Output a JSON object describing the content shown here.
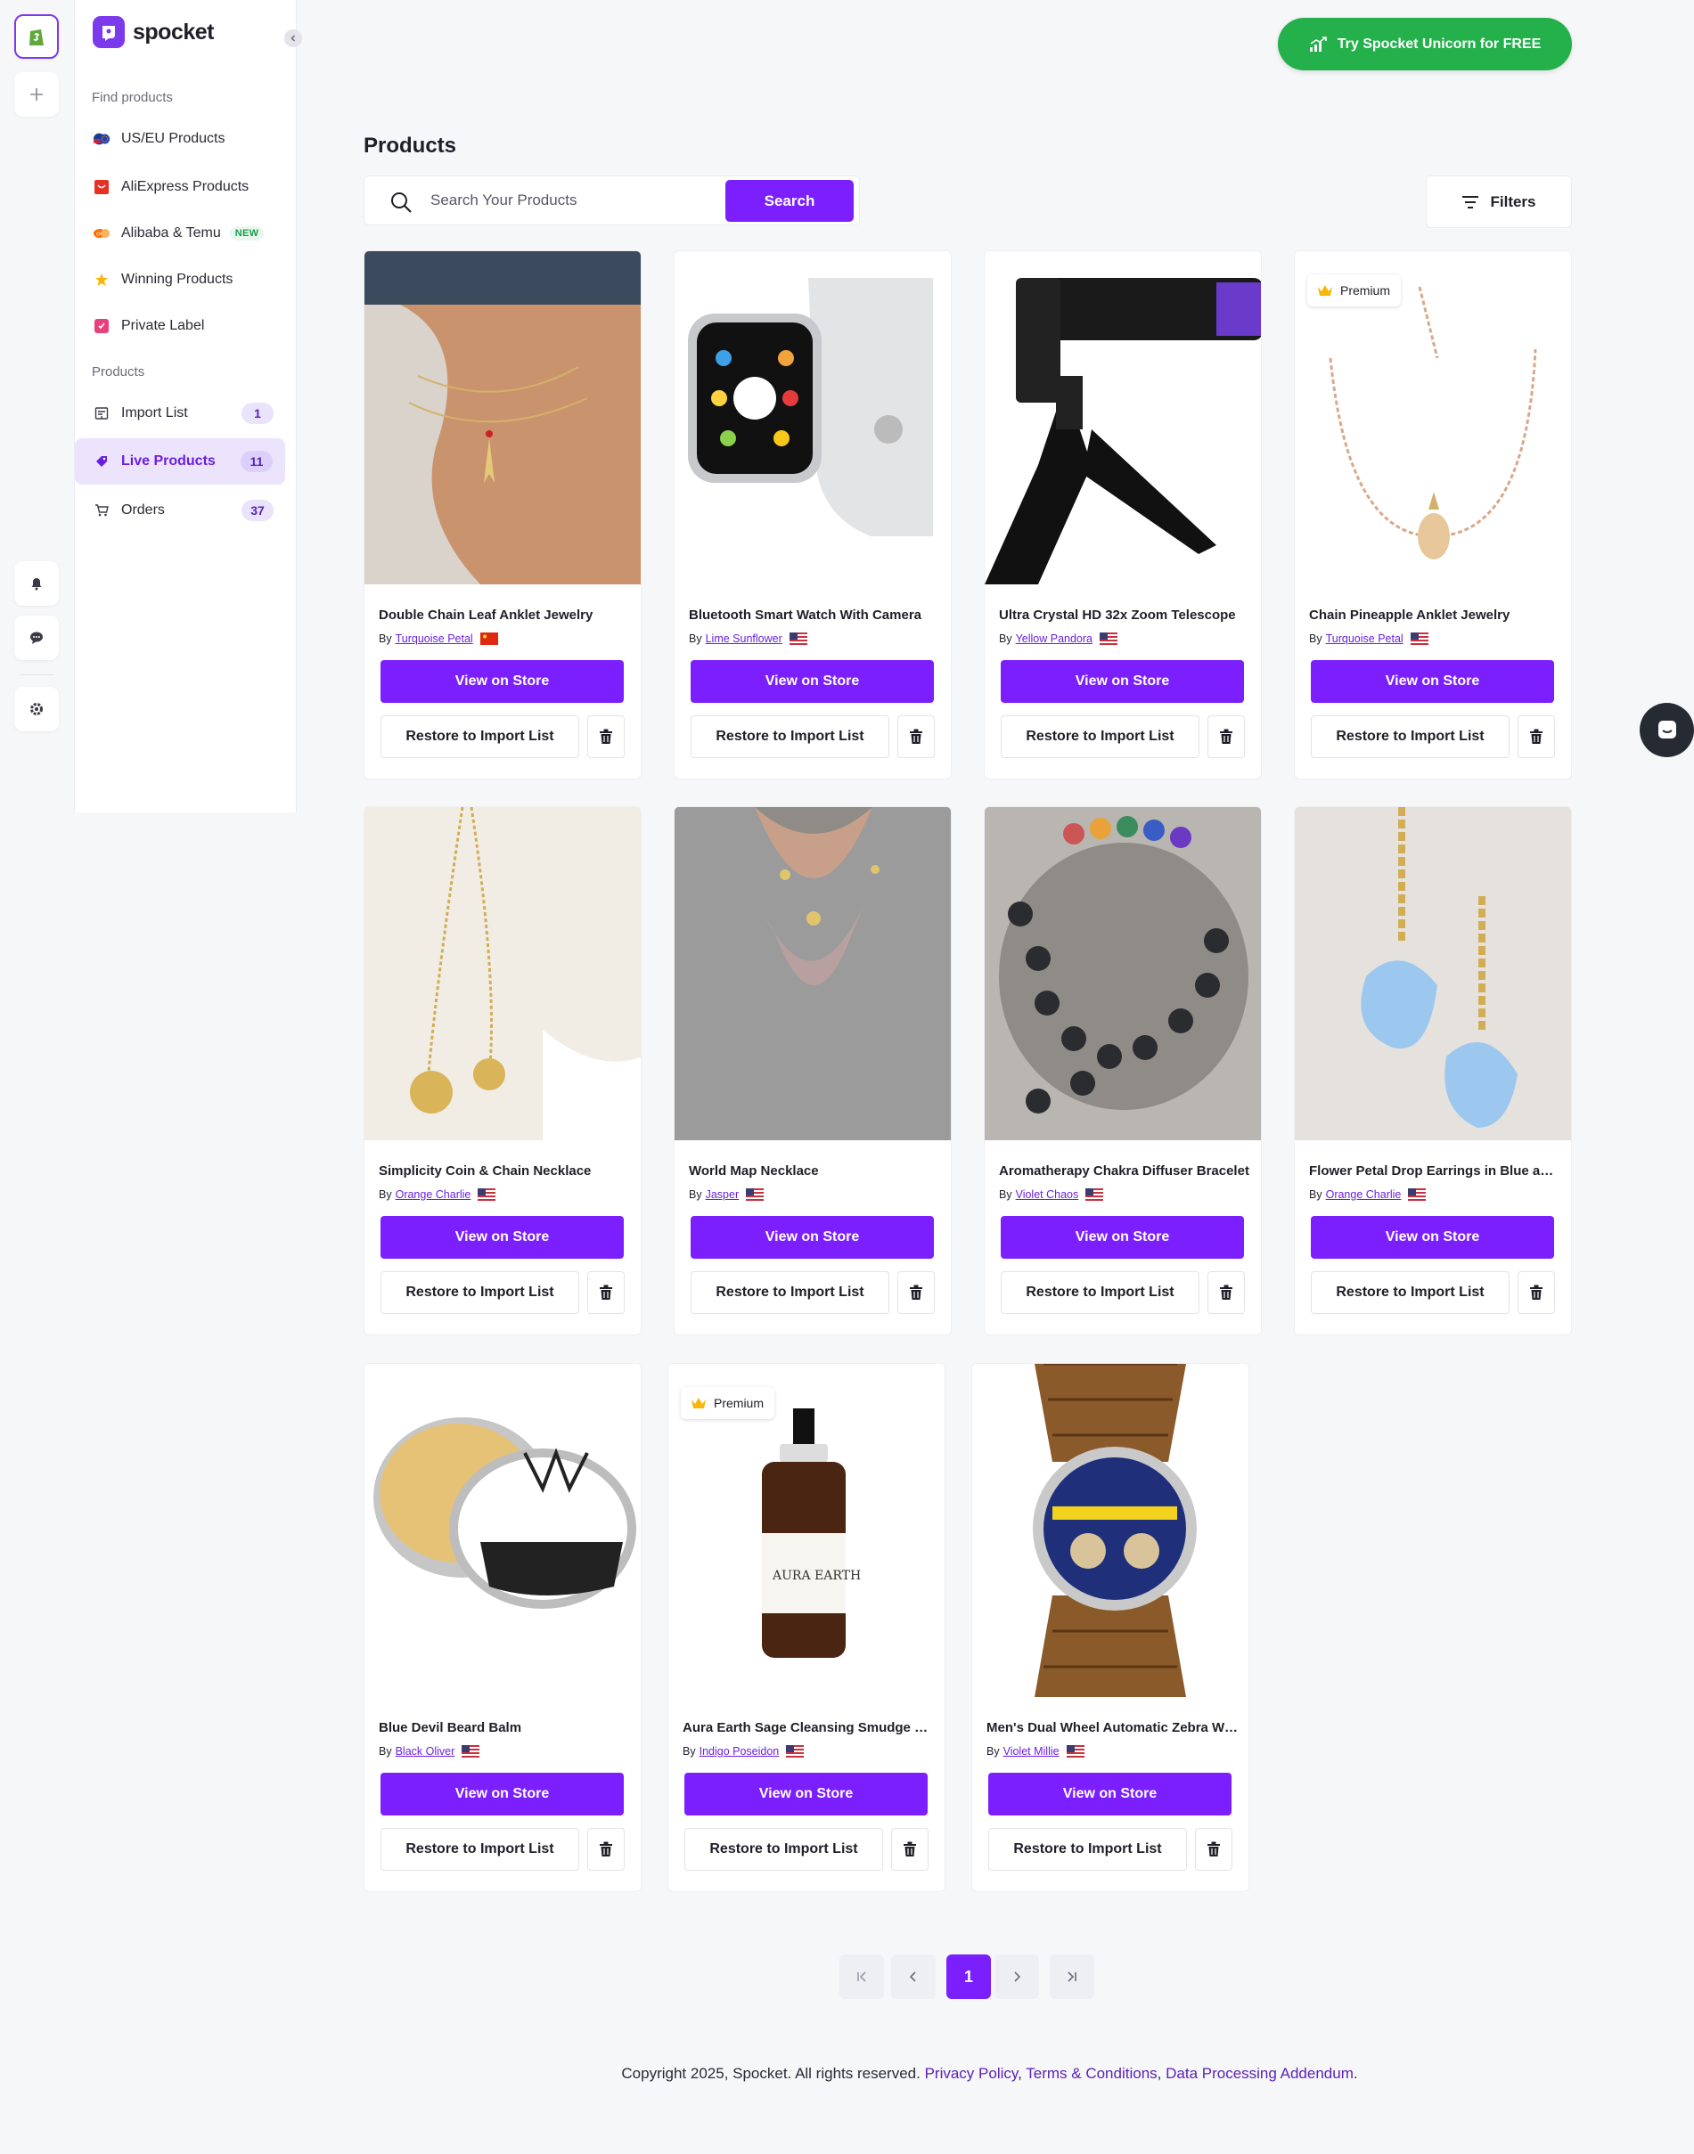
{
  "brand": {
    "name": "spocket",
    "accent": "#7c1fff",
    "cta_color": "#24b04b"
  },
  "header": {
    "cta_label": "Try Spocket Unicorn for FREE"
  },
  "sidebar": {
    "find_section": "Find products",
    "products_section": "Products",
    "items": [
      {
        "label": "US/EU Products",
        "icon": "us-eu-flag-icon"
      },
      {
        "label": "AliExpress Products",
        "icon": "aliexpress-icon"
      },
      {
        "label": "Alibaba & Temu",
        "icon": "alibaba-icon",
        "tag": "NEW"
      },
      {
        "label": "Winning Products",
        "icon": "star-icon"
      },
      {
        "label": "Private Label",
        "icon": "private-label-icon"
      },
      {
        "label": "Import List",
        "icon": "import-list-icon",
        "count": "1"
      },
      {
        "label": "Live Products",
        "icon": "tag-icon",
        "count": "11",
        "active": true
      },
      {
        "label": "Orders",
        "icon": "cart-icon",
        "count": "37"
      }
    ]
  },
  "main": {
    "title": "Products",
    "search": {
      "placeholder": "Search Your Products",
      "button": "Search"
    },
    "filters_label": "Filters"
  },
  "card_labels": {
    "view": "View on Store",
    "restore": "Restore to Import List",
    "by": "By",
    "premium": "Premium"
  },
  "products": [
    {
      "title": "Double Chain Leaf Anklet Jewelry",
      "supplier": "Turquoise Petal",
      "flag": "CN",
      "premium": false
    },
    {
      "title": "Bluetooth Smart Watch With Camera",
      "supplier": "Lime Sunflower",
      "flag": "US",
      "premium": false
    },
    {
      "title": "Ultra Crystal HD 32x Zoom Telescope",
      "supplier": "Yellow Pandora",
      "flag": "US",
      "premium": false
    },
    {
      "title": "Chain Pineapple Anklet Jewelry",
      "supplier": "Turquoise Petal",
      "flag": "US",
      "premium": true
    },
    {
      "title": "Simplicity Coin & Chain Necklace",
      "supplier": "Orange Charlie",
      "flag": "US",
      "premium": false
    },
    {
      "title": "World Map Necklace",
      "supplier": "Jasper",
      "flag": "US",
      "premium": false
    },
    {
      "title": "Aromatherapy Chakra Diffuser Bracelet",
      "supplier": "Violet Chaos",
      "flag": "US",
      "premium": false
    },
    {
      "title": "Flower Petal Drop Earrings in Blue and Gold",
      "supplier": "Orange Charlie",
      "flag": "US",
      "premium": false
    },
    {
      "title": "Blue Devil Beard Balm",
      "supplier": "Black Oliver",
      "flag": "US",
      "premium": false
    },
    {
      "title": "Aura Earth Sage Cleansing Smudge Spray",
      "supplier": "Indigo Poseidon",
      "flag": "US",
      "premium": true
    },
    {
      "title": "Men's Dual Wheel Automatic Zebra Wood Watch",
      "supplier": "Violet Millie",
      "flag": "US",
      "premium": false
    }
  ],
  "pagination": {
    "current": "1"
  },
  "footer": {
    "copyright": "Copyright 2025, Spocket. All rights reserved.",
    "privacy": "Privacy Policy",
    "terms": "Terms & Conditions",
    "dpa": "Data Processing Addendum"
  }
}
